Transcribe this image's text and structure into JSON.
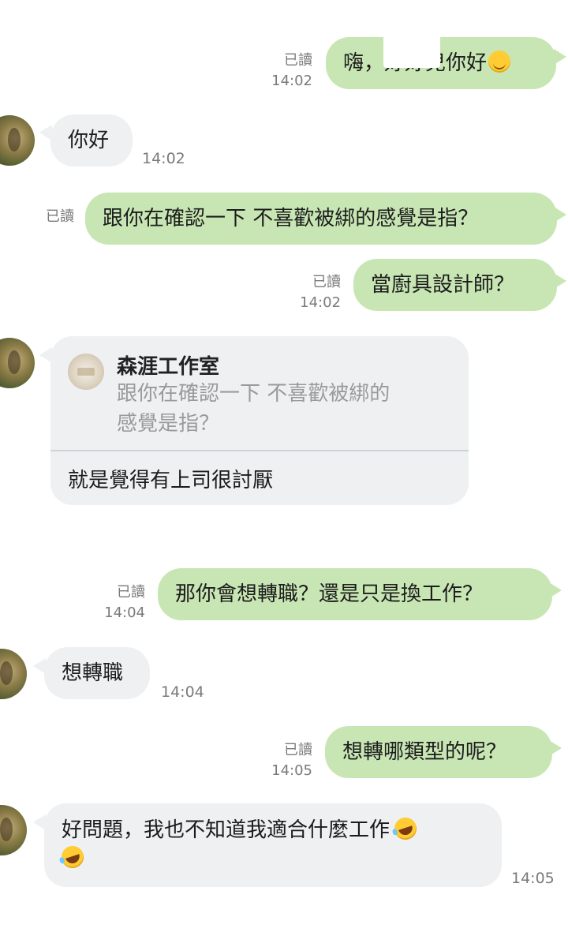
{
  "messages": [
    {
      "dir": "out",
      "text": "嗨，好好兒你好",
      "read": "已讀",
      "time": "14:02",
      "emoji": "smile-emoji"
    },
    {
      "dir": "in",
      "text": "你好",
      "time": "14:02"
    },
    {
      "dir": "out",
      "text": "跟你在確認一下 不喜歡被綁的感覺是指？",
      "read": "已讀"
    },
    {
      "dir": "out",
      "text": "當廚具設計師？",
      "read": "已讀",
      "time": "14:02"
    },
    {
      "dir": "in",
      "type": "reply",
      "quote_sender": "森涯工作室",
      "quote_text_line1": "跟你在確認一下 不喜歡被綁的",
      "quote_text_line2": "感覺是指？",
      "text": "就是覺得有上司很討厭"
    },
    {
      "dir": "out",
      "text": "那你會想轉職？還是只是換工作？",
      "read": "已讀",
      "time": "14:04"
    },
    {
      "dir": "in",
      "text": "想轉職",
      "time": "14:04"
    },
    {
      "dir": "out",
      "text": "想轉哪類型的呢？",
      "read": "已讀",
      "time": "14:05"
    },
    {
      "dir": "in",
      "text": "好問題，我也不知道我適合什麼工作",
      "time": "14:05",
      "emoji": "rofl-emoji"
    }
  ],
  "colors": {
    "outgoing_bubble": "#c8e6b4",
    "incoming_bubble": "#eef0f2",
    "meta_text": "#7a7a7a"
  }
}
